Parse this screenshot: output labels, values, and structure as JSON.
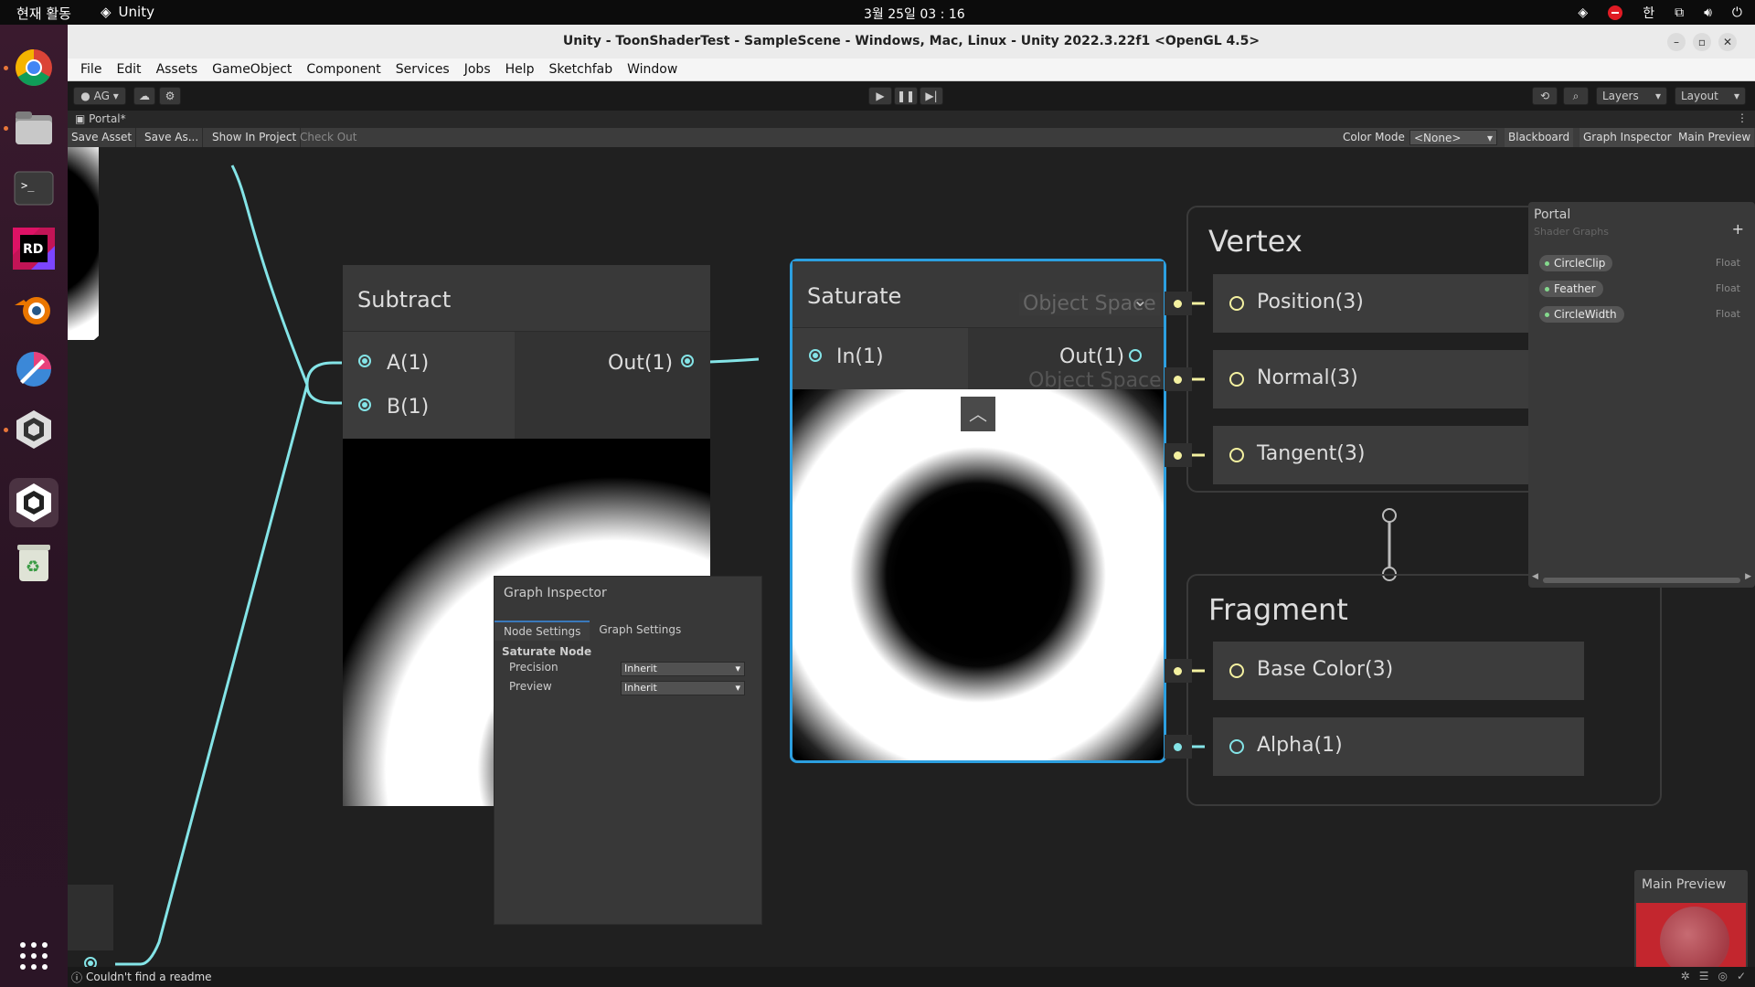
{
  "os_bar": {
    "activities": "현재 활동",
    "app_name": "Unity",
    "clock": "3월 25일 03 : 16",
    "ime": "한"
  },
  "dock": {
    "items": [
      "chrome-icon",
      "files-icon",
      "terminal-icon",
      "rider-icon",
      "blender-icon",
      "krita-icon",
      "unity-hub-icon",
      "unity-icon",
      "trash-icon",
      "apps-grid-icon"
    ]
  },
  "window": {
    "title": "Unity - ToonShaderTest - SampleScene - Windows, Mac, Linux - Unity 2022.3.22f1 <OpenGL 4.5>"
  },
  "menu": [
    "File",
    "Edit",
    "Assets",
    "GameObject",
    "Component",
    "Services",
    "Jobs",
    "Help",
    "Sketchfab",
    "Window"
  ],
  "toolbar": {
    "account": "AG",
    "layers": "Layers",
    "layout": "Layout"
  },
  "tab": {
    "name": "Portal*"
  },
  "sg_toolbar": {
    "save_asset": "Save Asset",
    "save_as": "Save As...",
    "show_in_project": "Show In Project",
    "check_out": "Check Out",
    "color_mode_label": "Color Mode",
    "color_mode_value": "<None>",
    "blackboard": "Blackboard",
    "graph_inspector": "Graph Inspector",
    "main_preview": "Main Preview"
  },
  "nodes": {
    "subtract": {
      "title": "Subtract",
      "in_a": "A(1)",
      "in_b": "B(1)",
      "out": "Out(1)"
    },
    "saturate": {
      "title": "Saturate",
      "in": "In(1)",
      "out": "Out(1)",
      "ghost_text": "Object Space"
    }
  },
  "master": {
    "vertex_title": "Vertex",
    "vertex_blocks": [
      "Position(3)",
      "Normal(3)",
      "Tangent(3)"
    ],
    "fragment_title": "Fragment",
    "fragment_blocks": [
      "Base Color(3)",
      "Alpha(1)"
    ]
  },
  "inspector": {
    "title": "Graph Inspector",
    "tab_node": "Node Settings",
    "tab_graph": "Graph Settings",
    "section": "Saturate Node",
    "precision_label": "Precision",
    "precision_value": "Inherit",
    "preview_label": "Preview",
    "preview_value": "Inherit"
  },
  "blackboard": {
    "title": "Portal",
    "subtitle": "Shader Graphs",
    "properties": [
      {
        "name": "CircleClip",
        "type": "Float"
      },
      {
        "name": "Feather",
        "type": "Float"
      },
      {
        "name": "CircleWidth",
        "type": "Float"
      }
    ]
  },
  "main_preview": {
    "title": "Main Preview"
  },
  "status": {
    "message": "Couldn't find a readme"
  },
  "colors": {
    "accent": "#84e4e7",
    "selection": "#2c9fe0",
    "pin_yellow": "#f4f1a0"
  }
}
